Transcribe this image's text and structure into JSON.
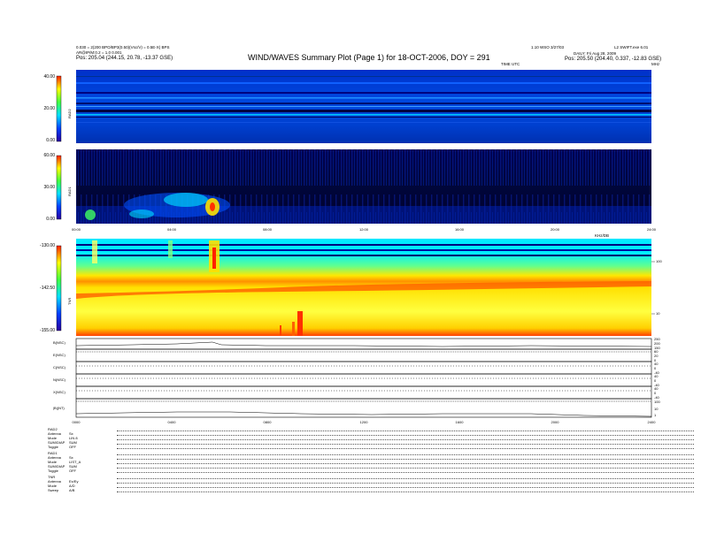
{
  "header": {
    "left_line1": "0.030 = 2(200 BPO/BP3(0.50)(Vsc/V) = 0.5E-X) BPS",
    "left_line2": "AR@IP/M:0.2 = 1.0 0.001",
    "left_line3": "Pos:   205.04 (244.15, 20.78, -13.37 GSE)",
    "title": "WIND/WAVES Summary Plot (Page 1) for 18-OCT-2006, DOY = 291",
    "right_line1a": "1.10 WSO 3/27/03",
    "right_line1b": "L2 SWIFT.exe 6.01",
    "right_line2": "DAILY: Fri Aug 28, 2009",
    "right_line3": "Pos:   205.50 (204.40, 0.337, -12.83 GSE)",
    "rad2_units": "MHz",
    "rad2_top_label": "TIME UTC"
  },
  "panels": {
    "rad2": {
      "label": "RAD2",
      "ticks": [
        "40.00",
        "20.00",
        "0.00"
      ]
    },
    "rad1": {
      "label": "RAD1",
      "ticks": [
        "60.00",
        "30.00",
        "0.00"
      ]
    },
    "tnr": {
      "label": "TNR",
      "ticks": [
        "-130.00",
        "-142.50",
        "-155.00"
      ],
      "right_ticks": [
        "100",
        "10"
      ],
      "top_right_label": "KHz/DB"
    }
  },
  "time_axis": {
    "labels": [
      "00:00",
      "04:00",
      "08:00",
      "12:00",
      "16:00",
      "20:00",
      "24:00"
    ]
  },
  "time_axis_lower": {
    "labels": [
      "0000",
      "0400",
      "0800",
      "1200",
      "1600",
      "2000",
      "2400"
    ]
  },
  "sub_panels": [
    {
      "label": "B(NSC)",
      "right": [
        "250",
        "200",
        "150"
      ]
    },
    {
      "label": "E(NSC)",
      "right": [
        "60",
        "20",
        "0"
      ]
    },
    {
      "label": "C(NSC)",
      "right": [
        "40",
        "0",
        "-40"
      ]
    },
    {
      "label": "N(NSC)",
      "right": [
        "40",
        "0",
        "-40"
      ]
    },
    {
      "label": "X(NSC)",
      "right": [
        "40",
        "0",
        "-40"
      ]
    },
    {
      "label": "|B|(NT)",
      "right": [
        "100",
        "10",
        "1"
      ]
    }
  ],
  "settings": {
    "rad2_header": "RAD2",
    "rad2": [
      {
        "key": "Antenna",
        "val": "Sx"
      },
      {
        "key": "Mode",
        "val": "LIN 8"
      },
      {
        "key": "SUM/DIAP",
        "val": "SUM"
      },
      {
        "key": "Toggle",
        "val": "OFF"
      }
    ],
    "rad1_header": "RAD1",
    "rad1": [
      {
        "key": "Antenna",
        "val": "Sx"
      },
      {
        "key": "Mode",
        "val": "LIST_A"
      },
      {
        "key": "SUM/DIAP",
        "val": "SUM"
      },
      {
        "key": "Toggle",
        "val": "OFF"
      }
    ],
    "tnr_header": "TNR",
    "tnr": [
      {
        "key": "Antenna",
        "val": "Ex/Ey"
      },
      {
        "key": "Mode",
        "val": "A/D"
      },
      {
        "key": "Sweep",
        "val": "A/B"
      }
    ]
  },
  "colors": {
    "background_low": "#00008b",
    "spectrum_mid": "#00ffff",
    "spectrum_high": "#ffff00",
    "spectrum_peak": "#ff0000"
  }
}
